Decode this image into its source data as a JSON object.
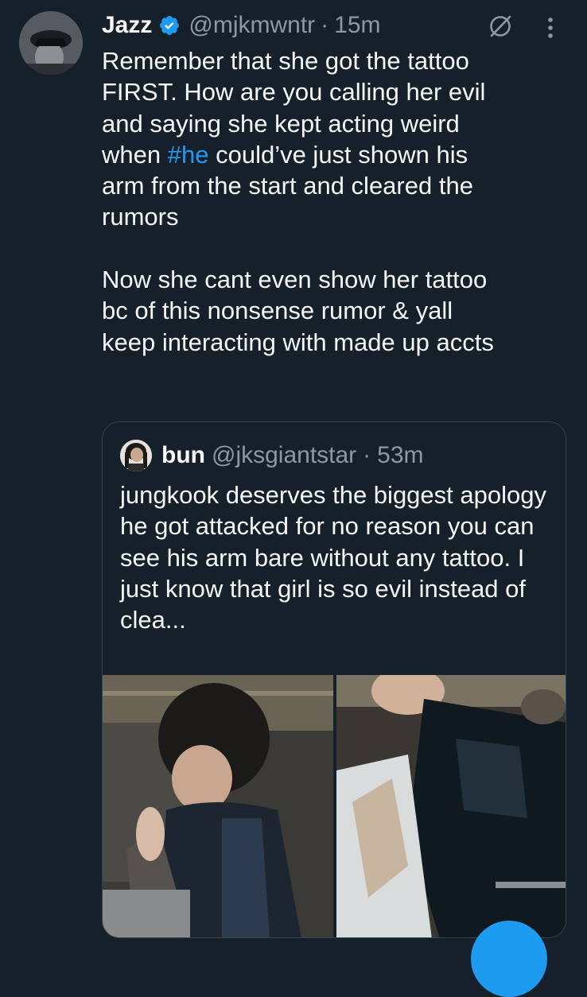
{
  "tweet": {
    "author_name": "Jazz",
    "handle": "@mjkmwntr",
    "separator": "·",
    "time": "15m",
    "text_before_hashtag": "Remember that she got the tattoo\nFIRST. How are you calling her evil\nand saying she kept acting weird\nwhen ",
    "hashtag": "#he",
    "text_after_hashtag": " could’ve just shown his\narm from the start and cleared the\nrumors\n\nNow she cant even show her tattoo\nbc of this nonsense rumor & yall\nkeep interacting with made up accts"
  },
  "quoted": {
    "author_name": "bun",
    "handle": "@jksgiantstar",
    "separator": "·",
    "time": "53m",
    "text": "jungkook deserves the biggest apology he got attacked for no reason you can see his arm bare without any tattoo. I just know that girl is so evil instead of clea..."
  },
  "icons": {
    "verified": "verified-badge-icon",
    "grok": "grok-icon",
    "more": "more-options-icon"
  },
  "colors": {
    "background": "#15202b",
    "text": "#f7f9f9",
    "secondary": "#8b98a5",
    "accent": "#1d9bf0",
    "border": "#38444d"
  }
}
